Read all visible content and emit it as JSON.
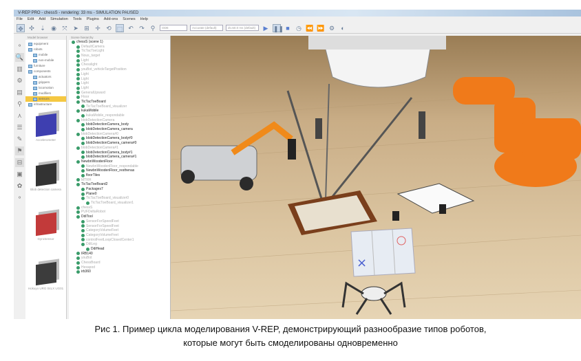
{
  "window": {
    "title": "V-REP PRO - chessS - rendering: 33 ms - SIMULATION PAUSED"
  },
  "menu": [
    "File",
    "Edit",
    "Add",
    "Simulation",
    "Tools",
    "Plugins",
    "Add-ons",
    "Scenes",
    "Help"
  ],
  "toolbar": {
    "engine": "ODE",
    "precision": "Accurate (default)",
    "timestep": "dt=50.0 ms (default)"
  },
  "panels": {
    "model_browser": "Model browser",
    "scene_hierarchy": "Scene hierarchy"
  },
  "model_folders": [
    {
      "label": "equipment",
      "indent": 0
    },
    {
      "label": "robots",
      "indent": 0
    },
    {
      "label": "mobile",
      "indent": 1
    },
    {
      "label": "non-mobile",
      "indent": 1
    },
    {
      "label": "furniture",
      "indent": 0
    },
    {
      "label": "components",
      "indent": 0
    },
    {
      "label": "actuators",
      "indent": 1
    },
    {
      "label": "grippers",
      "indent": 1
    },
    {
      "label": "locomotion",
      "indent": 1
    },
    {
      "label": "modifiers",
      "indent": 1
    },
    {
      "label": "sensors",
      "indent": 1,
      "selected": true
    },
    {
      "label": "infrastructure",
      "indent": 0
    }
  ],
  "models": [
    {
      "label": "Accelerometer",
      "color": "#3e3fb0"
    },
    {
      "label": "Blob detection camera",
      "color": "#333"
    },
    {
      "label": "GyroSensor",
      "color": "#c23a3a"
    },
    {
      "label": "Hokuyo URG 04LX UG01",
      "color": "#3c3c3c"
    }
  ],
  "hierarchy": [
    {
      "label": "chessS (scene 1)",
      "indent": 0,
      "style": "dark"
    },
    {
      "label": "DefaultCamera",
      "indent": 1,
      "style": "dim"
    },
    {
      "label": "TicTacToeLight",
      "indent": 1,
      "style": "dim"
    },
    {
      "label": "Nous_target",
      "indent": 1,
      "style": "dim"
    },
    {
      "label": "Light",
      "indent": 1,
      "style": "dim"
    },
    {
      "label": "Chesslight",
      "indent": 1,
      "style": "dim"
    },
    {
      "label": "youBot_vehicleTargetPosition",
      "indent": 1,
      "style": "dim"
    },
    {
      "label": "Light",
      "indent": 1,
      "style": "dim"
    },
    {
      "label": "Light",
      "indent": 1,
      "style": "dim"
    },
    {
      "label": "Light",
      "indent": 1,
      "style": "dim"
    },
    {
      "label": "Light",
      "indent": 1,
      "style": "dim"
    },
    {
      "label": "GeneralUpward",
      "indent": 1,
      "style": "dim"
    },
    {
      "label": "Floor",
      "indent": 1,
      "style": "dim"
    },
    {
      "label": "TicTacToeBoard",
      "indent": 1,
      "style": "dark"
    },
    {
      "label": "TicTacToeBoard_visualizer",
      "indent": 2,
      "style": "dim"
    },
    {
      "label": "kukaMobile",
      "indent": 1,
      "style": "dark"
    },
    {
      "label": "kukaMobile_respondable",
      "indent": 2,
      "style": "dim"
    },
    {
      "label": "blobDetectionCamera",
      "indent": 1,
      "style": "dim"
    },
    {
      "label": "blobDetectionCamera_body",
      "indent": 2,
      "style": "dark"
    },
    {
      "label": "blobDetectionCamera_camera",
      "indent": 2,
      "style": "dark"
    },
    {
      "label": "blobDetectionCamera#0",
      "indent": 1,
      "style": "dim"
    },
    {
      "label": "blobDetectionCamera_body#0",
      "indent": 2,
      "style": "dark"
    },
    {
      "label": "blobDetectionCamera_camera#0",
      "indent": 2,
      "style": "dark"
    },
    {
      "label": "blobDetectionCamera#1",
      "indent": 1,
      "style": "dim"
    },
    {
      "label": "blobDetectionCamera_body#1",
      "indent": 2,
      "style": "dark"
    },
    {
      "label": "blobDetectionCamera_camera#1",
      "indent": 2,
      "style": "dark"
    },
    {
      "label": "NewbnWoodenFloor",
      "indent": 1,
      "style": "dark"
    },
    {
      "label": "NewbnWoodenFloor_respondable",
      "indent": 2,
      "style": "dim"
    },
    {
      "label": "NewbnWoodenFloor_resthenas",
      "indent": 2,
      "style": "dark"
    },
    {
      "label": "floorTiles",
      "indent": 2,
      "style": "dark"
    },
    {
      "label": "MTRH",
      "indent": 1,
      "style": "dim"
    },
    {
      "label": "TicTacToeBoard2",
      "indent": 1,
      "style": "dark"
    },
    {
      "label": "Packages7",
      "indent": 2,
      "style": "dark"
    },
    {
      "label": "Plane0",
      "indent": 2,
      "style": "dark"
    },
    {
      "label": "TicTacToeBoard_visualizer0",
      "indent": 2,
      "style": "dim"
    },
    {
      "label": "TicTacToeBoard_visualizer1",
      "indent": 3,
      "style": "dim"
    },
    {
      "label": "chessS",
      "indent": 1,
      "style": "dim"
    },
    {
      "label": "PUFDeltaRobot",
      "indent": 1,
      "style": "dim"
    },
    {
      "label": "DdiTool",
      "indent": 1,
      "style": "dark"
    },
    {
      "label": "SensorForSpeedFeet",
      "indent": 2,
      "style": "dim"
    },
    {
      "label": "SensorForSpeedFeet",
      "indent": 2,
      "style": "dim"
    },
    {
      "label": "CategoryVolumeFeet",
      "indent": 2,
      "style": "dim"
    },
    {
      "label": "CategoryVolumeFeet",
      "indent": 2,
      "style": "dim"
    },
    {
      "label": "controlFeetLoopClosedCenter1",
      "indent": 2,
      "style": "dim"
    },
    {
      "label": "DdiLeg",
      "indent": 2,
      "style": "dim"
    },
    {
      "label": "DdiHead",
      "indent": 3,
      "style": "dark"
    },
    {
      "label": "IRB140",
      "indent": 1,
      "style": "dark"
    },
    {
      "label": "youBot",
      "indent": 1,
      "style": "dim"
    },
    {
      "label": "ChessBoard",
      "indent": 1,
      "style": "dim"
    },
    {
      "label": "Hexapod",
      "indent": 1,
      "style": "dim"
    },
    {
      "label": "irb360",
      "indent": 1,
      "style": "dark"
    }
  ],
  "caption": {
    "line1": "Рис 1. Пример цикла моделирования V-REP, демонстрирующий разнообразие типов роботов,",
    "line2": "которые могут быть смоделированы одновременно"
  },
  "colors": {
    "robot_orange": "#f07a1a",
    "floor": "#d7bf98"
  }
}
